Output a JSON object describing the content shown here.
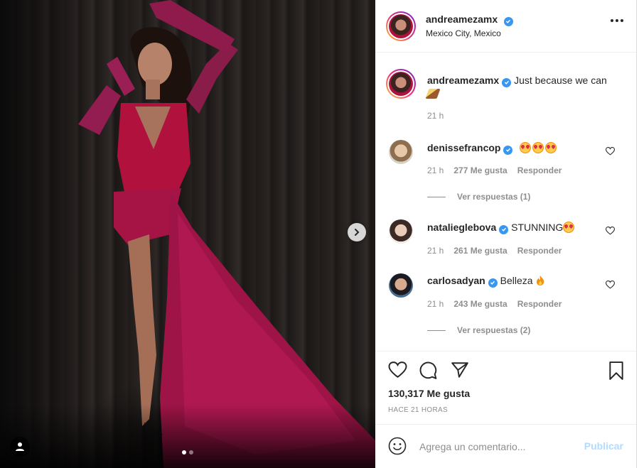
{
  "post": {
    "author": "andreamezamx",
    "location": "Mexico City, Mexico",
    "caption": "Just because we can",
    "caption_time": "21 h"
  },
  "comments": [
    {
      "username": "denissefrancop",
      "text": "",
      "time": "21 h",
      "likes": "277 Me gusta",
      "reply_label": "Responder",
      "view_replies": "Ver respuestas (1)"
    },
    {
      "username": "natalieglebova",
      "text": "STUNNING",
      "time": "21 h",
      "likes": "261 Me gusta",
      "reply_label": "Responder"
    },
    {
      "username": "carlosadyan",
      "text": "Belleza",
      "time": "21 h",
      "likes": "243 Me gusta",
      "reply_label": "Responder",
      "view_replies": "Ver respuestas (2)"
    }
  ],
  "stats": {
    "likes": "130,317 Me gusta",
    "time_ago": "HACE 21 HORAS"
  },
  "composer": {
    "placeholder": "Agrega un comentario...",
    "publish_label": "Publicar"
  },
  "carousel": {
    "count": 2,
    "active": 1
  },
  "colors": {
    "dress": "#b0123d",
    "verified": "#3897f0",
    "publish_disabled": "#b3dbff"
  },
  "icons": [
    "heart-icon",
    "comment-icon",
    "share-icon",
    "bookmark-icon",
    "emoji-icon",
    "more-icon",
    "chevron-right-icon",
    "user-tag-icon",
    "verified-icon",
    "fire-emoji",
    "heart-eyes-emoji",
    "champagne-emoji"
  ]
}
